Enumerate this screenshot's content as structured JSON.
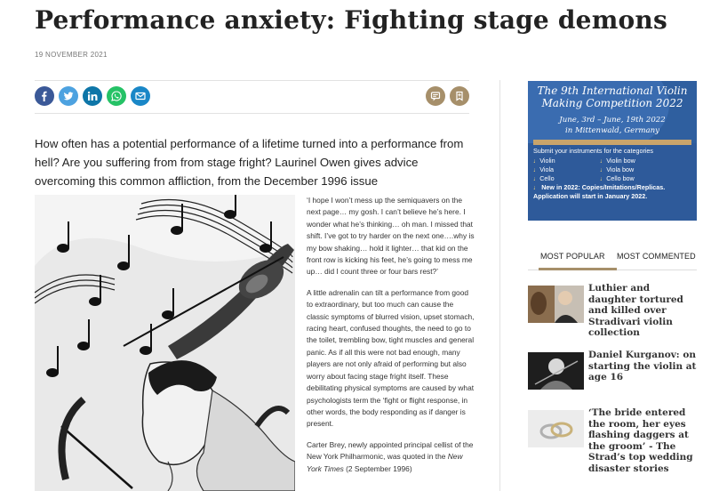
{
  "article": {
    "title": "Performance anxiety: Fighting stage demons",
    "date": "19 NOVEMBER 2021",
    "standfirst": "How often has a potential performance of a lifetime turned into a performance from hell? Are you suffering from from stage fright? Laurinel Owen gives advice overcoming this common affliction, from the December 1996 issue",
    "paragraphs": [
      "‘I hope I won’t mess up the semiquavers on the next page… my gosh. I can’t believe he’s here. I wonder what he’s thinking… oh man. I missed that shift. I’ve got to try harder on the next one….why is my bow shaking… hold it lighter… that kid on the front row is kicking his feet, he’s going to mess me up… did I count three or four bars rest?’",
      "A little adrenalin can tilt a performance from good to extraordinary, but too much can cause the classic symptoms of blurred vision, upset stomach, racing heart, confused thoughts, the need to go to the toilet, trembling bow, tight muscles and general panic. As if all this were not bad enough, many players are not only afraid of performing but also worry about facing stage fright itself. These debilitating physical symptoms are caused by what psychologists term the ‘fight or flight response, in other words, the body responding as if danger is present."
    ],
    "p3_start": "Carter Brey, newly appointed principal cellist of the New York Philharmonic, was quoted in the ",
    "p3_italic": "New York Times",
    "p3_end": " (2 September 1996)"
  },
  "share_icons": [
    "facebook-icon",
    "twitter-icon",
    "linkedin-icon",
    "whatsapp-icon",
    "email-icon"
  ],
  "tool_icons": [
    "comment-icon",
    "bookmark-icon"
  ],
  "ad": {
    "heading": "The 9th International Violin Making Competition 2022",
    "dates": "June, 3rd – June, 19th 2022",
    "location": "in Mittenwald, Germany",
    "submit": "Submit your instruments for the categories",
    "categories": [
      "Violin",
      "Violin bow",
      "Viola",
      "Viola bow",
      "Cello",
      "Cello bow"
    ],
    "new_line": "New in 2022: Copies/Imitations/Replicas.",
    "start_line": "Application will start in January 2022."
  },
  "sidebar": {
    "tab_popular": "MOST POPULAR",
    "tab_commented": "MOST COMMENTED",
    "items": [
      {
        "headline": "Luthier and daughter tortured and killed over Stradivari violin collection"
      },
      {
        "headline": "Daniel Kurganov: on starting the violin at age 16"
      },
      {
        "headline": "‘The bride entered the room, her eyes flashing daggers at the groom’ - The Strad’s top wedding disaster stories"
      }
    ]
  },
  "colors": {
    "accent": "#a68f6a",
    "facebook": "#3b5998",
    "twitter": "#4da2e0",
    "linkedin": "#0e76a8",
    "whatsapp": "#25c266",
    "email": "#1a87c7",
    "ad_blue": "#2e5a9a"
  }
}
